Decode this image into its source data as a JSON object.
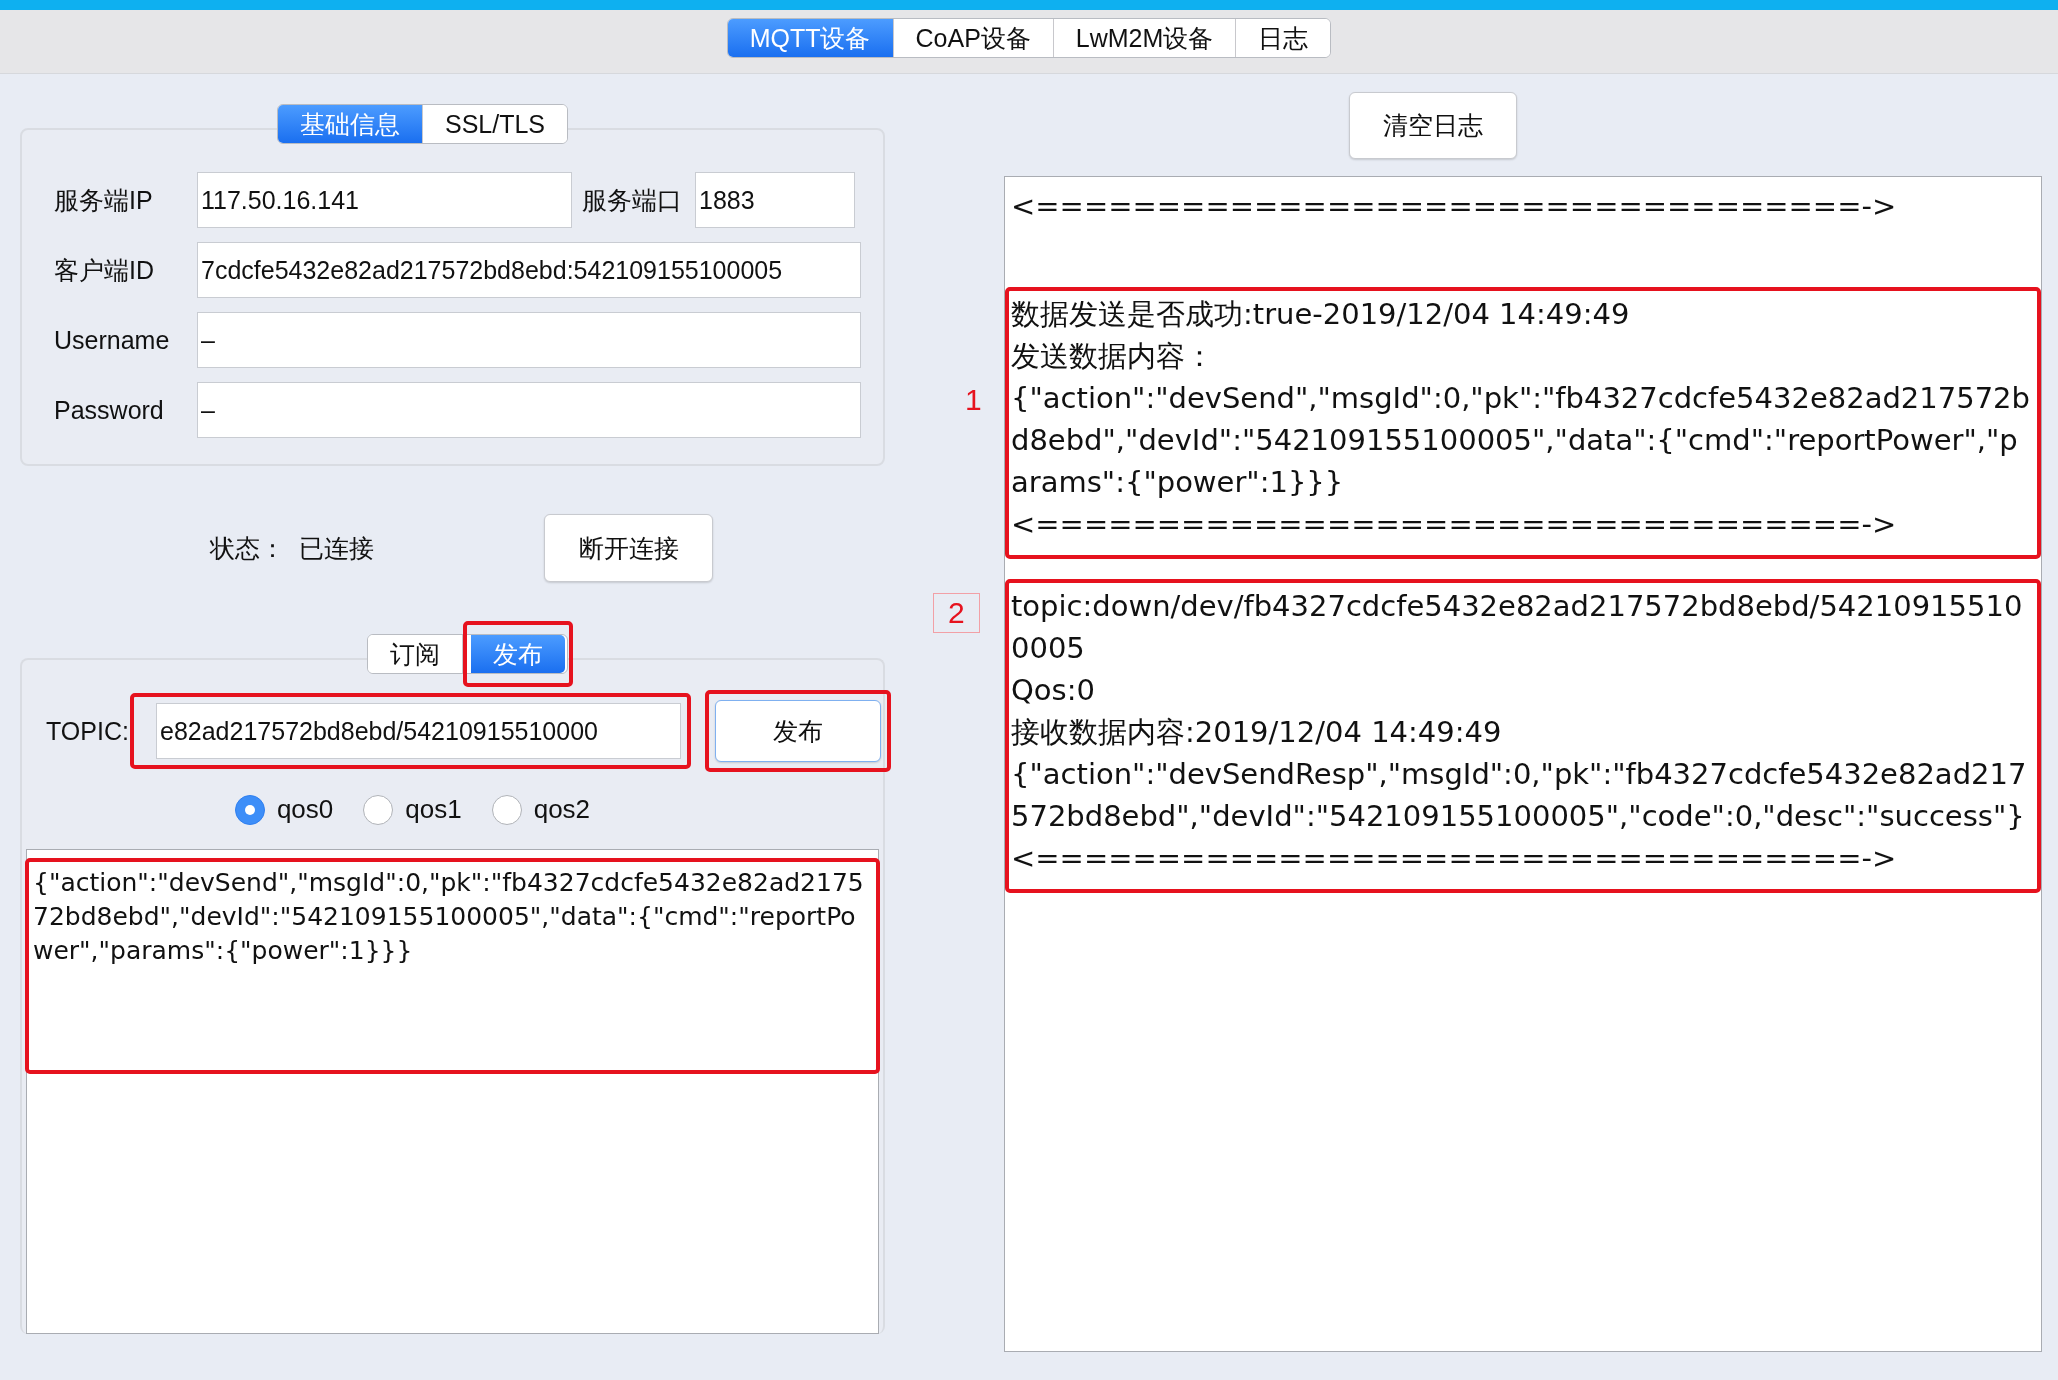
{
  "top_tabs": [
    {
      "label": "MQTT设备",
      "selected": true
    },
    {
      "label": "CoAP设备",
      "selected": false
    },
    {
      "label": "LwM2M设备",
      "selected": false
    },
    {
      "label": "日志",
      "selected": false
    }
  ],
  "connection": {
    "tabs": [
      {
        "label": "基础信息",
        "selected": true
      },
      {
        "label": "SSL/TLS",
        "selected": false
      }
    ],
    "server_ip": {
      "label": "服务端IP",
      "value": "117.50.16.141"
    },
    "server_port": {
      "label": "服务端口",
      "value": "1883"
    },
    "client_id": {
      "label": "客户端ID",
      "value": "7cdcfe5432e82ad217572bd8ebd:542109155100005"
    },
    "username": {
      "label": "Username",
      "value": "–"
    },
    "password": {
      "label": "Password",
      "value": "–"
    }
  },
  "status": {
    "label": "状态：",
    "value": "已连接"
  },
  "disconnect_button": "断开连接",
  "message_tabs": [
    {
      "label": "订阅",
      "selected": false,
      "annotated": false
    },
    {
      "label": "发布",
      "selected": true,
      "annotated": true
    }
  ],
  "topic": {
    "label": "TOPIC:",
    "value": "e82ad217572bd8ebd/54210915510000",
    "annotated": true
  },
  "publish_button": {
    "label": "发布",
    "annotated": true
  },
  "qos": [
    {
      "label": "qos0",
      "selected": true
    },
    {
      "label": "qos1",
      "selected": false
    },
    {
      "label": "qos2",
      "selected": false
    }
  ],
  "payload": {
    "value": "{\"action\":\"devSend\",\"msgId\":0,\"pk\":\"fb4327cdcfe5432e82ad217572bd8ebd\",\"devId\":\"542109155100005\",\"data\":{\"cmd\":\"reportPower\",\"params\":{\"power\":1}}}",
    "annotated": true
  },
  "clear_log_button": "清空日志",
  "log": [
    {
      "lines": [
        "<==================================->"
      ],
      "annotated": false
    },
    {
      "marker": "1",
      "marker_framed": false,
      "annotated": true,
      "lines": [
        "数据发送是否成功:true-2019/12/04 14:49:49",
        "发送数据内容：",
        "{\"action\":\"devSend\",\"msgId\":0,\"pk\":\"fb4327cdcfe5432e82ad217572bd8ebd\",\"devId\":\"542109155100005\",\"data\":{\"cmd\":\"reportPower\",\"params\":{\"power\":1}}}",
        "<==================================->"
      ]
    },
    {
      "marker": "2",
      "marker_framed": true,
      "annotated": true,
      "lines": [
        "topic:down/dev/fb4327cdcfe5432e82ad217572bd8ebd/542109155100005",
        "Qos:0",
        "接收数据内容:2019/12/04 14:49:49",
        "{\"action\":\"devSendResp\",\"msgId\":0,\"pk\":\"fb4327cdcfe5432e82ad217572bd8ebd\",\"devId\":\"542109155100005\",\"code\":0,\"desc\":\"success\"}",
        "<==================================->"
      ]
    }
  ]
}
